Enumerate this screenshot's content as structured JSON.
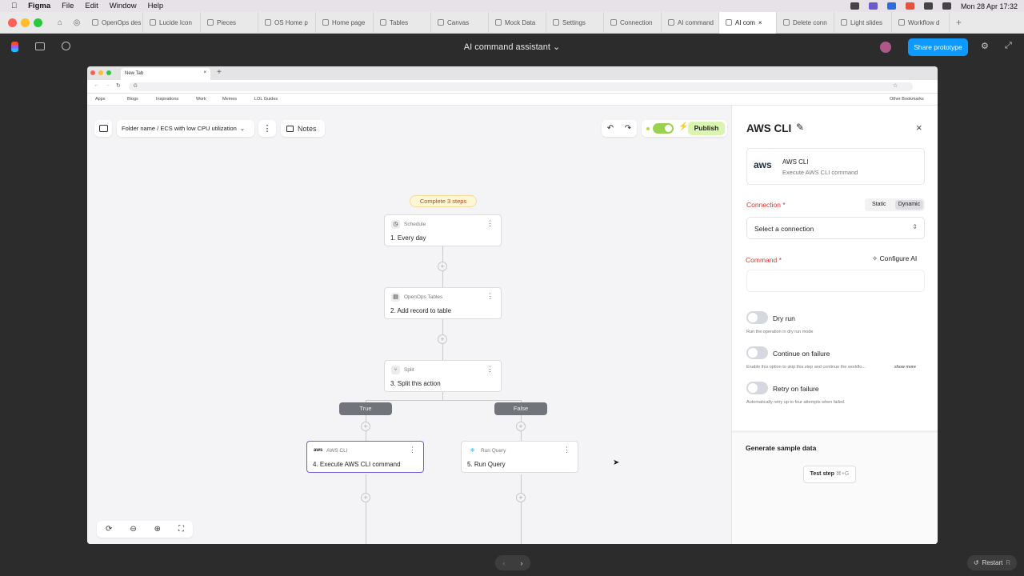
{
  "menubar": {
    "apple": "",
    "app": "Figma",
    "items": [
      "File",
      "Edit",
      "Window",
      "Help"
    ],
    "datetime": "Mon 28 Apr  17:32"
  },
  "figma_tabs": [
    "OpenOps des",
    "Lucide Icon",
    "Pieces",
    "OS Home p",
    "Home page",
    "Tables",
    "Canvas",
    "Mock Data",
    "Settings",
    "Connection",
    "AI command",
    "AI com",
    "Delete conn",
    "Light slides",
    "Workflow d"
  ],
  "figma": {
    "title": "AI command assistant",
    "share": "Share prototype"
  },
  "browser": {
    "tab": "New Tab",
    "url": "G",
    "bookmarks": [
      "Apps",
      "Blogs",
      "Inspirations",
      "Work",
      "Memes",
      "LOL Guides"
    ],
    "other_bookmarks": "Other Bookmarks"
  },
  "app": {
    "breadcrumb": "Folder name / ECS with low CPU utilization",
    "notes": "Notes",
    "publish": "Publish",
    "steps_badge": "Complete 3 steps"
  },
  "nodes": [
    {
      "kind": "Schedule",
      "title": "1. Every day",
      "icon": "clock-icon"
    },
    {
      "kind": "OpenOps Tables",
      "title": "2. Add record to table",
      "icon": "table-icon"
    },
    {
      "kind": "Split",
      "title": "3. Split this action",
      "icon": "split-icon"
    },
    {
      "kind": "AWS CLI",
      "title": "4. Execute AWS CLI command",
      "icon": "aws-icon"
    },
    {
      "kind": "Run Query",
      "title": "5. Run Query",
      "icon": "snowflake-icon"
    }
  ],
  "branches": {
    "true": "True",
    "false": "False"
  },
  "panel": {
    "title": "AWS CLI",
    "card_title": "AWS CLI",
    "card_sub": "Execute AWS CLI command",
    "connection_label": "Connection",
    "req": "*",
    "static": "Static",
    "dynamic": "Dynamic",
    "select_placeholder": "Select a connection",
    "command_label": "Command",
    "configure_ai": "Configure AI",
    "dry_run": "Dry run",
    "dry_run_sub": "Run the operation in dry run mode",
    "continue": "Continue on failure",
    "continue_sub": "Enable this option to skip this step and continue the workflo...",
    "show_more": "show more",
    "retry": "Retry on failure",
    "retry_sub": "Automatically retry up to four attempts when failed.",
    "generate": "Generate sample data",
    "test_step": "Test step",
    "shortcut": "⌘+G"
  },
  "footer": {
    "restart": "Restart",
    "restart_key": "R"
  }
}
